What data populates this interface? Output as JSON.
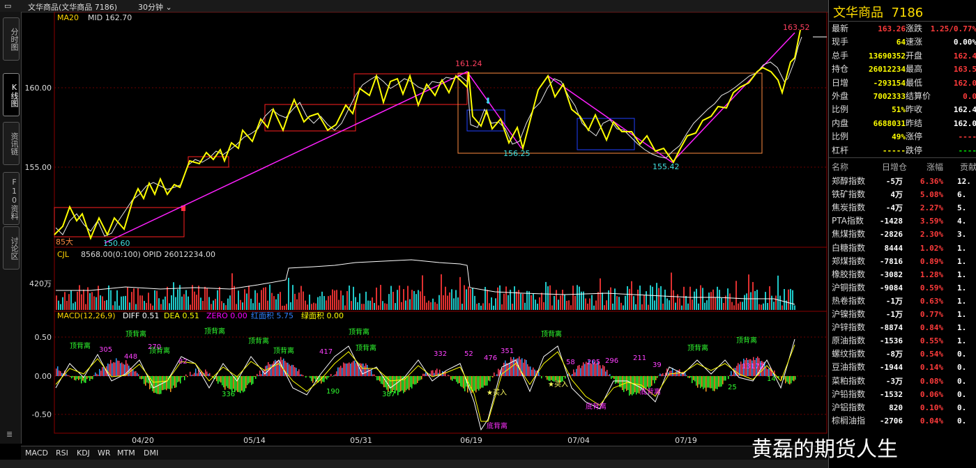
{
  "titlebar": {
    "name": "文华商品(文华商品 7186)",
    "period": "30分钟"
  },
  "sidetabs": [
    "分时图",
    "K线图",
    "资讯链",
    "F10资料",
    "讨论区"
  ],
  "main": {
    "ma_label": "MA20",
    "mid_label": "MID 162.70",
    "price_ticks": [
      "160.00",
      "155.00"
    ],
    "annotations": {
      "p16352": "163.52",
      "p16124": "161.24",
      "p15625": "156.25",
      "p15542": "155.42",
      "p15060": "150.60",
      "left_cut": "85大"
    }
  },
  "volume": {
    "label": "CJL",
    "value": "8568.00(0:100)",
    "opid": "OPID 26012234.00",
    "tick": "420万"
  },
  "macd": {
    "label": "MACD(12,26,9)",
    "diff": "DIFF 0.51",
    "dea": "DEA 0.51",
    "zero": "ZERO 0.00",
    "red_area": "红面积 5.75",
    "green_area": "绿面积 0.00",
    "ticks": [
      "0.50",
      "0.00",
      "-0.50"
    ],
    "top_divs": [
      "顶背离",
      "顶背离",
      "顶背离",
      "顶背离",
      "顶背离",
      "顶背离",
      "顶背离",
      "顶背离",
      "顶背离",
      "顶背离",
      "顶背离"
    ],
    "bottom_divs": [
      "底背离",
      "底背离",
      "底背离"
    ],
    "buy_labels": [
      "买入",
      "买入"
    ],
    "numbers_top": [
      "305",
      "448",
      "270",
      "82",
      "417",
      "332",
      "52",
      "476",
      "351",
      "58",
      "205",
      "296",
      "211",
      "39",
      "13172"
    ],
    "numbers_bottom": [
      "336",
      "190",
      "387",
      "25",
      "14"
    ]
  },
  "x_dates": [
    "04/20",
    "05/14",
    "05/31",
    "06/19",
    "07/04",
    "07/19"
  ],
  "bottom_tabs": [
    "MACD",
    "RSI",
    "KDJ",
    "WR",
    "MTM",
    "DMI"
  ],
  "quote": {
    "title": "文华商品",
    "code": "7186",
    "left": [
      {
        "k": "最新",
        "v": "163.26",
        "c": "red"
      },
      {
        "k": "现手",
        "v": "64",
        "c": "yellow"
      },
      {
        "k": "总手",
        "v": "13690352",
        "c": "yellow"
      },
      {
        "k": "持仓",
        "v": "26012234",
        "c": "yellow"
      },
      {
        "k": "日增",
        "v": "-293154",
        "c": "yellow"
      },
      {
        "k": "外盘",
        "v": "7002333",
        "c": "yellow"
      },
      {
        "k": "比例",
        "v": "51%",
        "c": "yellow"
      },
      {
        "k": "内盘",
        "v": "6688031",
        "c": "yellow"
      },
      {
        "k": "比例",
        "v": "49%",
        "c": "yellow"
      },
      {
        "k": "杠杆",
        "v": "-----",
        "c": "yellow"
      }
    ],
    "right": [
      {
        "k": "涨跌",
        "v": "1.25/0.77%",
        "c": "red"
      },
      {
        "k": "速涨",
        "v": "0.00%",
        "c": "white"
      },
      {
        "k": "开盘",
        "v": "162.4",
        "c": "red"
      },
      {
        "k": "最高",
        "v": "163.5",
        "c": "red"
      },
      {
        "k": "最低",
        "v": "162.0",
        "c": "red"
      },
      {
        "k": "结算价",
        "v": "0.0",
        "c": "red"
      },
      {
        "k": "昨收",
        "v": "162.4",
        "c": "white"
      },
      {
        "k": "昨结",
        "v": "162.0",
        "c": "white"
      },
      {
        "k": "涨停",
        "v": "----",
        "c": "red"
      },
      {
        "k": "跌停",
        "v": "----",
        "c": "green"
      }
    ]
  },
  "index_table": {
    "headers": [
      "名称",
      "日增仓",
      "涨幅",
      "贡献"
    ],
    "rows": [
      [
        "郑醇指数",
        "-5万",
        "6.36%",
        "12."
      ],
      [
        "铁矿指数",
        "4万",
        "5.08%",
        "6."
      ],
      [
        "焦炭指数",
        "-4万",
        "2.27%",
        "5."
      ],
      [
        "PTA指数",
        "-1428",
        "3.59%",
        "4."
      ],
      [
        "焦煤指数",
        "-2826",
        "2.30%",
        "3."
      ],
      [
        "白糖指数",
        "8444",
        "1.02%",
        "1."
      ],
      [
        "郑煤指数",
        "-7816",
        "0.89%",
        "1."
      ],
      [
        "橡胶指数",
        "-3082",
        "1.28%",
        "1."
      ],
      [
        "沪铜指数",
        "-9084",
        "0.59%",
        "1."
      ],
      [
        "热卷指数",
        "-1万",
        "0.63%",
        "1."
      ],
      [
        "沪镍指数",
        "-1万",
        "0.77%",
        "1."
      ],
      [
        "沪锌指数",
        "-8874",
        "0.84%",
        "1."
      ],
      [
        "原油指数",
        "-1536",
        "0.55%",
        "1."
      ],
      [
        "螺纹指数",
        "-8万",
        "0.54%",
        "0."
      ],
      [
        "豆油指数",
        "-1944",
        "0.14%",
        "0."
      ],
      [
        "菜粕指数",
        "-3万",
        "0.08%",
        "0."
      ],
      [
        "沪铅指数",
        "-1532",
        "0.06%",
        "0."
      ],
      [
        "沪铝指数",
        "820",
        "0.10%",
        "0."
      ],
      [
        "棕榈油指",
        "-2706",
        "0.04%",
        "0."
      ]
    ]
  },
  "watermark": "黄磊的期货人生"
}
